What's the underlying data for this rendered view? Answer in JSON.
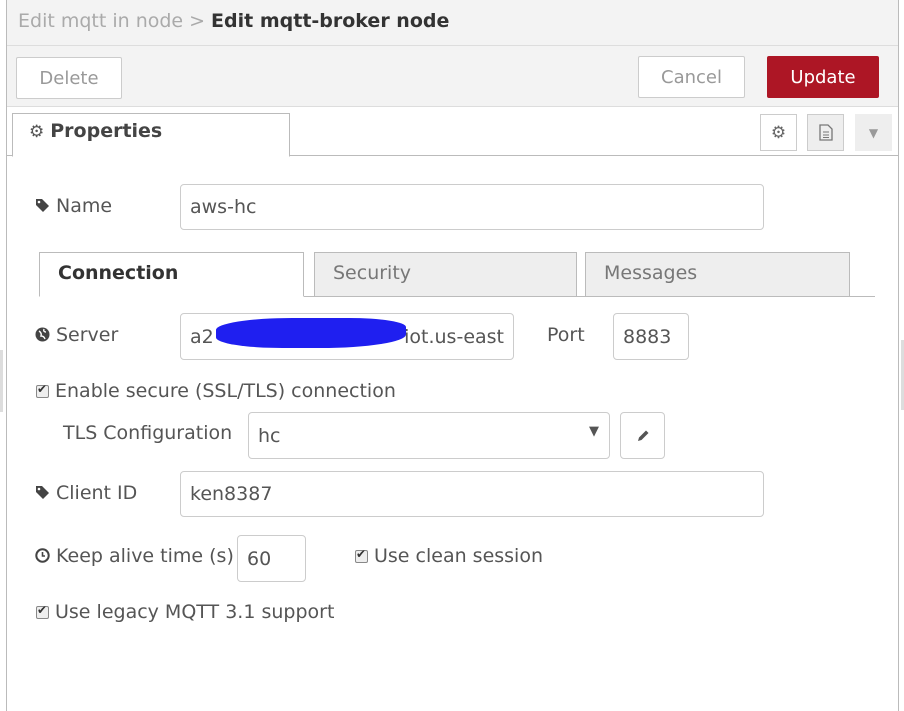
{
  "header": {
    "breadcrumb_parent": "Edit mqtt in node",
    "breadcrumb_sep": ">",
    "title": "Edit mqtt-broker node"
  },
  "toolbar": {
    "delete_label": "Delete",
    "cancel_label": "Cancel",
    "update_label": "Update"
  },
  "tabs": {
    "properties_label": "Properties",
    "gear_icon": "⚙",
    "doc_icon": "🗎",
    "more_icon": "▼"
  },
  "form": {
    "name_label": "Name",
    "name_value": "aws-hc",
    "connection_tabs": [
      "Connection",
      "Security",
      "Messages"
    ],
    "server_label": "Server",
    "server_value_prefix": "a2",
    "server_value_suffix": "iot.us-east",
    "port_label": "Port",
    "port_value": "8883",
    "ssl_label": "Enable secure (SSL/TLS) connection",
    "tls_label": "TLS Configuration",
    "tls_value": "hc",
    "client_id_label": "Client ID",
    "client_id_value": "ken8387",
    "keepalive_label": "Keep alive time (s)",
    "keepalive_value": "60",
    "clean_session_label": "Use clean session",
    "legacy_label": "Use legacy MQTT 3.1 support"
  },
  "colors": {
    "accent": "#ad1625",
    "redaction": "#1f1ff0"
  }
}
